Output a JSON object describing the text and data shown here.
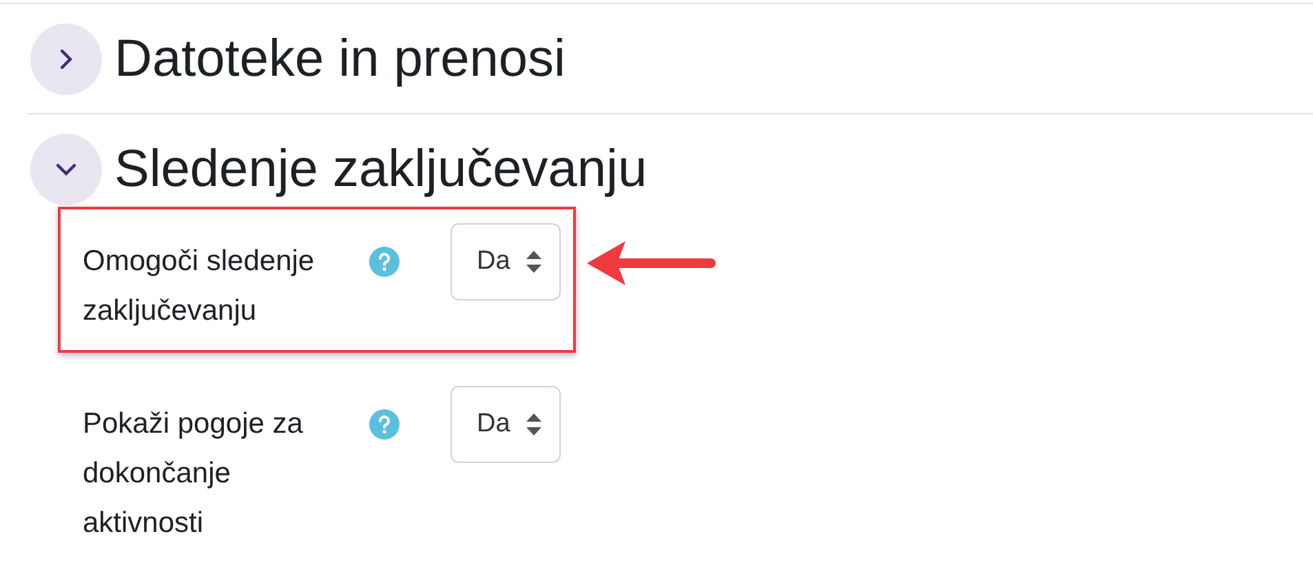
{
  "sections": [
    {
      "title": "Datoteke in prenosi",
      "expanded": false
    },
    {
      "title": "Sledenje zaključevanju",
      "expanded": true,
      "fields": [
        {
          "label": "Omogoči sledenje zaključevanju",
          "value": "Da",
          "highlighted": true
        },
        {
          "label": "Pokaži pogoje za dokončanje aktivnosti",
          "value": "Da",
          "highlighted": false
        }
      ]
    }
  ]
}
